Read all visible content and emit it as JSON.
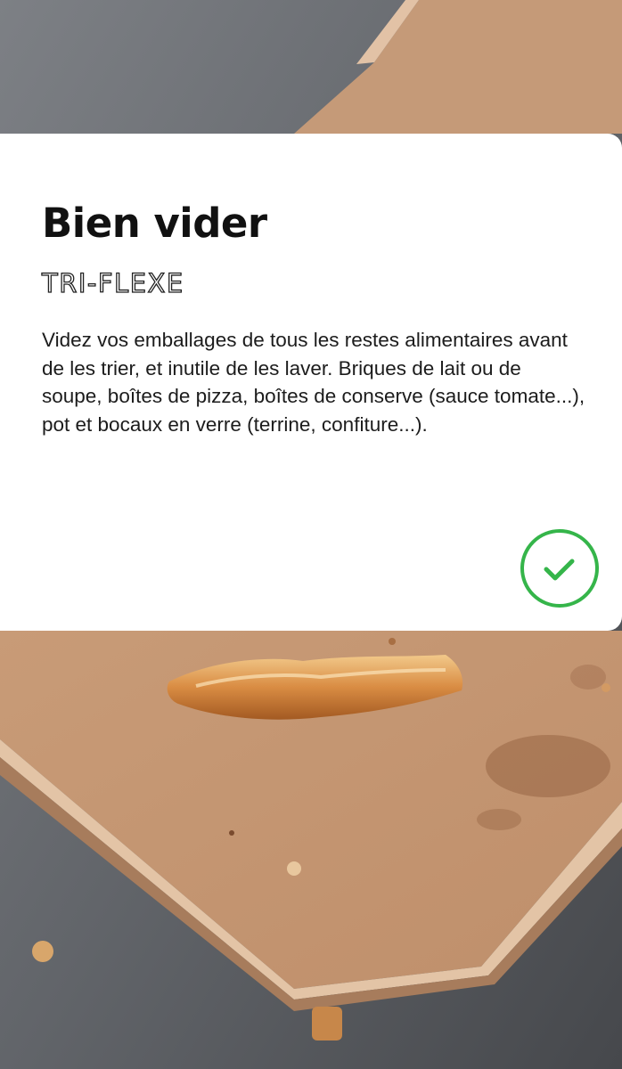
{
  "card": {
    "title": "Bien vider",
    "brand": "TRI-FLEXE",
    "description": "Videz vos emballages de tous les restes alimentaires avant de les trier, et inutile de les laver. Briques de lait ou de soupe, boîtes de pizza, boîtes de conserve (sauce tomate...), pot et bocaux en verre (terrine, confiture...).",
    "action_icon": "check-circle-icon"
  },
  "colors": {
    "accent_green": "#35b54a",
    "card_background": "#ffffff",
    "text": "#1c1c1c",
    "cardboard": "#c99d7b"
  },
  "background": {
    "icon": "pizza-box-photo"
  }
}
